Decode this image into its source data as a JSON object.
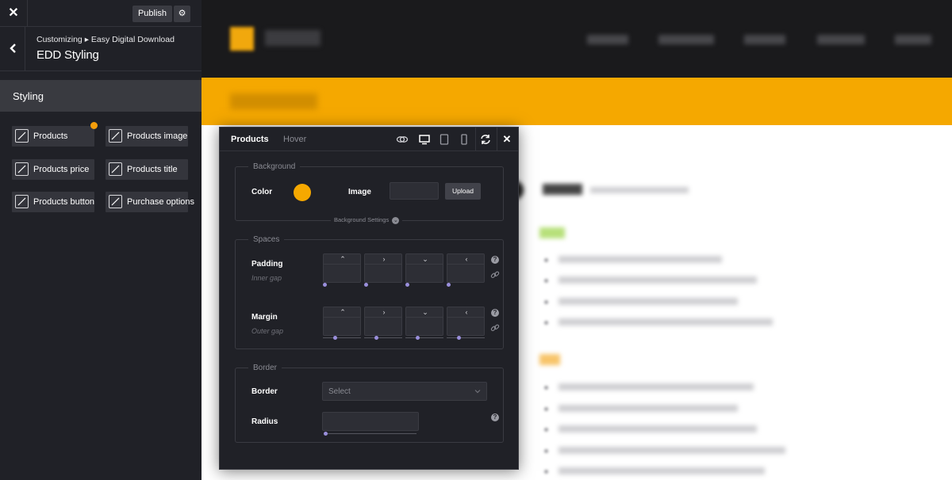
{
  "topbar": {
    "close_icon": "close-icon",
    "publish_label": "Publish",
    "gear_icon": "gear-icon"
  },
  "header": {
    "breadcrumb": "Customizing ▸ Easy Digital Download",
    "title": "EDD Styling"
  },
  "section": {
    "label": "Styling"
  },
  "style_items": [
    {
      "label": "Products",
      "edited": true
    },
    {
      "label": "Products image",
      "edited": false
    },
    {
      "label": "Products price",
      "edited": false
    },
    {
      "label": "Products title",
      "edited": false
    },
    {
      "label": "Products button",
      "edited": false
    },
    {
      "label": "Purchase options",
      "edited": false
    }
  ],
  "modal": {
    "tabs": [
      {
        "label": "Products",
        "active": true
      },
      {
        "label": "Hover",
        "active": false
      }
    ],
    "toolbar_icons": [
      "link-toggle-icon",
      "desktop-icon",
      "tablet-icon",
      "mobile-icon",
      "refresh-icon",
      "close-icon"
    ],
    "background": {
      "title": "Background",
      "color_label": "Color",
      "color_value": "#f5a800",
      "image_label": "Image",
      "upload_label": "Upload",
      "settings_label": "Background Settings"
    },
    "spaces": {
      "title": "Spaces",
      "padding_label": "Padding",
      "padding_sub": "Inner gap",
      "margin_label": "Margin",
      "margin_sub": "Outer gap",
      "directions": [
        "up",
        "right",
        "down",
        "left"
      ]
    },
    "border": {
      "title": "Border",
      "border_label": "Border",
      "border_placeholder": "Select",
      "radius_label": "Radius"
    }
  },
  "colors": {
    "accent": "#f5a800",
    "sidebar_bg": "#202127",
    "section_bg": "#393a40",
    "slider_knob": "#9a8fdc"
  }
}
